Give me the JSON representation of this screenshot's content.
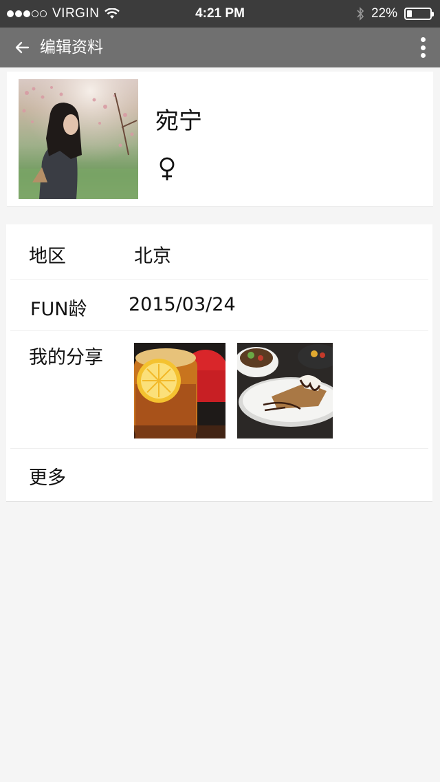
{
  "status_bar": {
    "carrier": "VIRGIN",
    "time": "4:21 PM",
    "battery_percent": "22%",
    "battery_level": 0.22,
    "signal_bars_filled": 3,
    "signal_bars_total": 5
  },
  "nav": {
    "title": "编辑资料",
    "back_icon": "arrow-left-icon",
    "more_icon": "more-vertical-icon"
  },
  "profile": {
    "name": "宛宁",
    "gender_symbol": "♀"
  },
  "info": {
    "region_label": "地区",
    "region_value": "北京",
    "fun_age_label": "FUN龄",
    "fun_age_value": "2015/03/24",
    "shares_label": "我的分享",
    "more_label": "更多"
  },
  "colors": {
    "status_bar_bg": "#3c3c3c",
    "nav_bar_bg": "#707070",
    "page_bg": "#f5f5f5"
  }
}
